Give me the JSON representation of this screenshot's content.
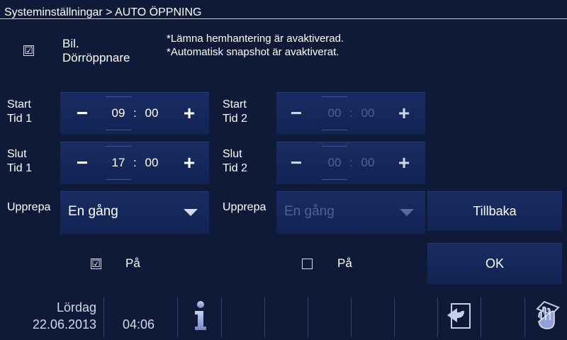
{
  "header": {
    "title": "Systeminställningar > AUTO ÖPPNING"
  },
  "car_opener": {
    "label_line1": "Bil.",
    "label_line2": "Dörröppnare",
    "checked_glyph": "☑",
    "note_line1": "*Lämna hemhantering är avaktiverad.",
    "note_line2": "*Automatisk snapshot är avaktiverat."
  },
  "schedule1": {
    "start_label1": "Start",
    "start_label2": "Tid 1",
    "start_hour": "09",
    "start_min": "00",
    "end_label1": "Slut",
    "end_label2": "Tid 1",
    "end_hour": "17",
    "end_min": "00",
    "repeat_label": "Upprepa",
    "repeat_value": "En gång",
    "on_label": "På",
    "on_checked": true
  },
  "schedule2": {
    "start_label1": "Start",
    "start_label2": "Tid 2",
    "start_hour": "00",
    "start_min": "00",
    "end_label1": "Slut",
    "end_label2": "Tid 2",
    "end_hour": "00",
    "end_min": "00",
    "repeat_label": "Upprepa",
    "repeat_value": "En gång",
    "on_label": "På",
    "on_checked": false
  },
  "controls": {
    "minus": "−",
    "plus": "+",
    "colon": ":"
  },
  "buttons": {
    "back": "Tillbaka",
    "ok": "OK"
  },
  "footer": {
    "day": "Lördag",
    "date": "22.06.2013",
    "time": "04:06"
  },
  "colors": {
    "background": "#0f1a38",
    "panel": "#162a5e",
    "disabled_text": "#4e6294"
  }
}
